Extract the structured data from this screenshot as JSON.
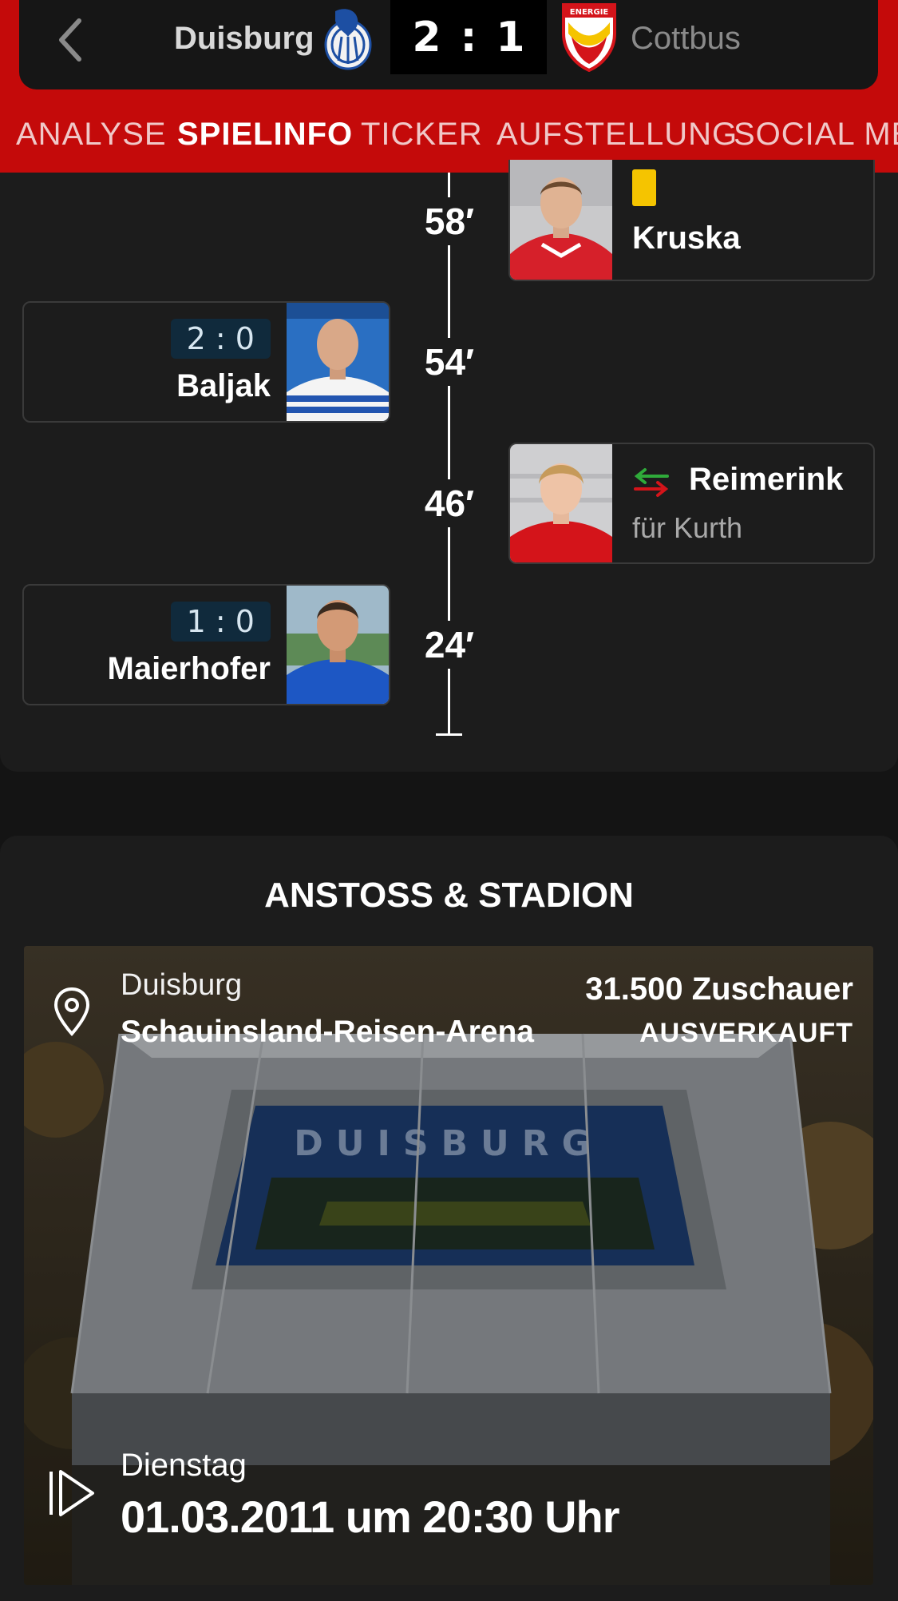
{
  "header": {
    "home_team": "Duisburg",
    "away_team": "Cottbus",
    "home_score": "2",
    "score_separator": ":",
    "away_score": "1",
    "away_crest_text": "ENERGIE",
    "colors": {
      "accent_red": "#c40a0a",
      "bar": "#161616"
    }
  },
  "tabs": [
    {
      "label": "ANALYSE",
      "active": false
    },
    {
      "label": "SPIELINFO",
      "active": true
    },
    {
      "label": "TICKER",
      "active": false
    },
    {
      "label": "AUFSTELLUNG",
      "active": false
    },
    {
      "label": "SOCIAL MEDIA",
      "active": false
    }
  ],
  "events": [
    {
      "minute": "58′",
      "side": "away",
      "type": "yellow-card",
      "player": "Kruska"
    },
    {
      "minute": "54′",
      "side": "home",
      "type": "goal",
      "score": "2 : 0",
      "player": "Baljak"
    },
    {
      "minute": "46′",
      "side": "away",
      "type": "substitution",
      "player": "Reimerink",
      "detail": "für Kurth"
    },
    {
      "minute": "24′",
      "side": "home",
      "type": "goal",
      "score": "1 : 0",
      "player": "Maierhofer"
    }
  ],
  "venue": {
    "section_title": "ANSTOSS & STADION",
    "city": "Duisburg",
    "stadium": "Schauinsland-Reisen-Arena",
    "attendance": "31.500 Zuschauer",
    "status": "AUSVERKAUFT",
    "stadium_lettering": "DUISBURG",
    "weekday": "Dienstag",
    "kickoff": "01.03.2011 um 20:30 Uhr"
  }
}
